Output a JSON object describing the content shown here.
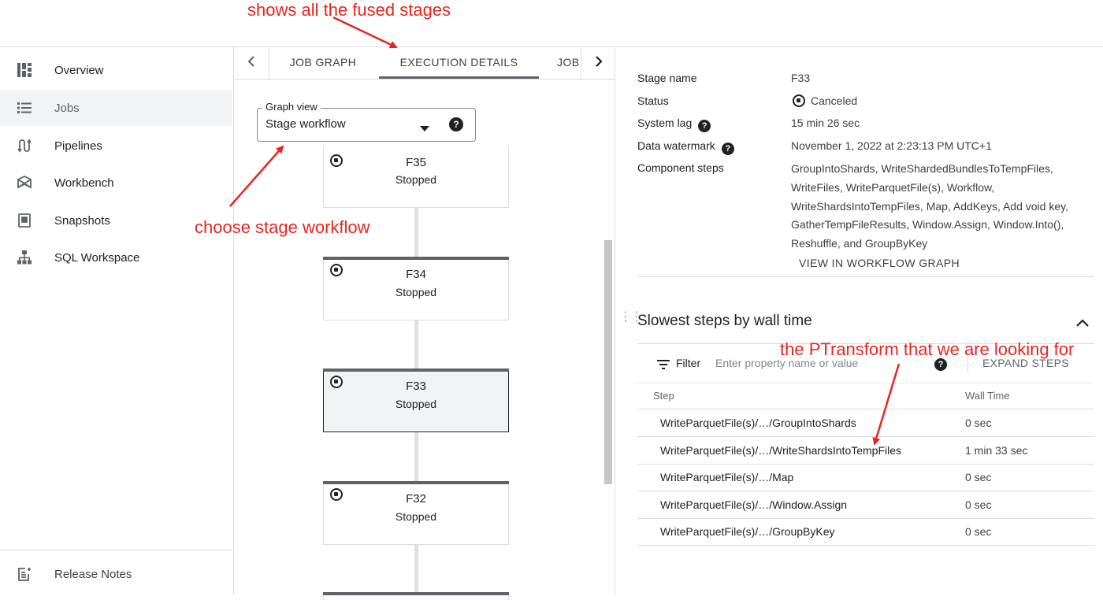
{
  "sidebar": {
    "items": [
      {
        "label": "Overview",
        "icon": "dashboard-icon"
      },
      {
        "label": "Jobs",
        "icon": "list-icon"
      },
      {
        "label": "Pipelines",
        "icon": "pipelines-icon"
      },
      {
        "label": "Workbench",
        "icon": "workbench-icon"
      },
      {
        "label": "Snapshots",
        "icon": "snapshot-icon"
      },
      {
        "label": "SQL Workspace",
        "icon": "hierarchy-icon"
      }
    ],
    "release_notes": "Release Notes",
    "active_item": "Jobs"
  },
  "tabs": {
    "items": [
      "JOB GRAPH",
      "EXECUTION DETAILS",
      "JOB"
    ],
    "active": "EXECUTION DETAILS"
  },
  "graph_view": {
    "label": "Graph view",
    "value": "Stage workflow"
  },
  "stages": [
    {
      "name": "F35",
      "status": "Stopped"
    },
    {
      "name": "F34",
      "status": "Stopped"
    },
    {
      "name": "F33",
      "status": "Stopped",
      "selected": true
    },
    {
      "name": "F32",
      "status": "Stopped"
    }
  ],
  "details": {
    "stage_name_label": "Stage name",
    "stage_name_value": "F33",
    "status_label": "Status",
    "status_value": "Canceled",
    "system_lag_label": "System lag",
    "system_lag_value": "15 min 26 sec",
    "data_watermark_label": "Data watermark",
    "data_watermark_value": "November 1, 2022 at 2:23:13 PM UTC+1",
    "component_steps_label": "Component steps",
    "component_steps_value": "GroupIntoShards, WriteShardedBundlesToTempFiles, WriteFiles, WriteParquetFile(s), Workflow, WriteShardsIntoTempFiles, Map, AddKeys, Add void key, GatherTempFileResults, Window.Assign, Window.Into(), Reshuffle, and GroupByKey",
    "view_link": "VIEW IN WORKFLOW GRAPH"
  },
  "slowest_steps": {
    "title": "Slowest steps by wall time",
    "filter_label": "Filter",
    "filter_placeholder": "Enter property name or value",
    "expand_button": "EXPAND STEPS",
    "columns": [
      "Step",
      "Wall Time"
    ],
    "rows": [
      {
        "step": "WriteParquetFile(s)/…/GroupIntoShards",
        "time": "0 sec"
      },
      {
        "step": "WriteParquetFile(s)/…/WriteShardsIntoTempFiles",
        "time": "1 min 33 sec"
      },
      {
        "step": "WriteParquetFile(s)/…/Map",
        "time": "0 sec"
      },
      {
        "step": "WriteParquetFile(s)/…/Window.Assign",
        "time": "0 sec"
      },
      {
        "step": "WriteParquetFile(s)/…/GroupByKey",
        "time": "0 sec"
      }
    ]
  },
  "annotations": {
    "fused": "shows all the fused stages",
    "workflow": "choose stage workflow",
    "ptransform": "the PTransform that we are looking for"
  },
  "colors": {
    "annotation": "#e8251f",
    "selected_stage_bg": "#f1f3f4"
  }
}
